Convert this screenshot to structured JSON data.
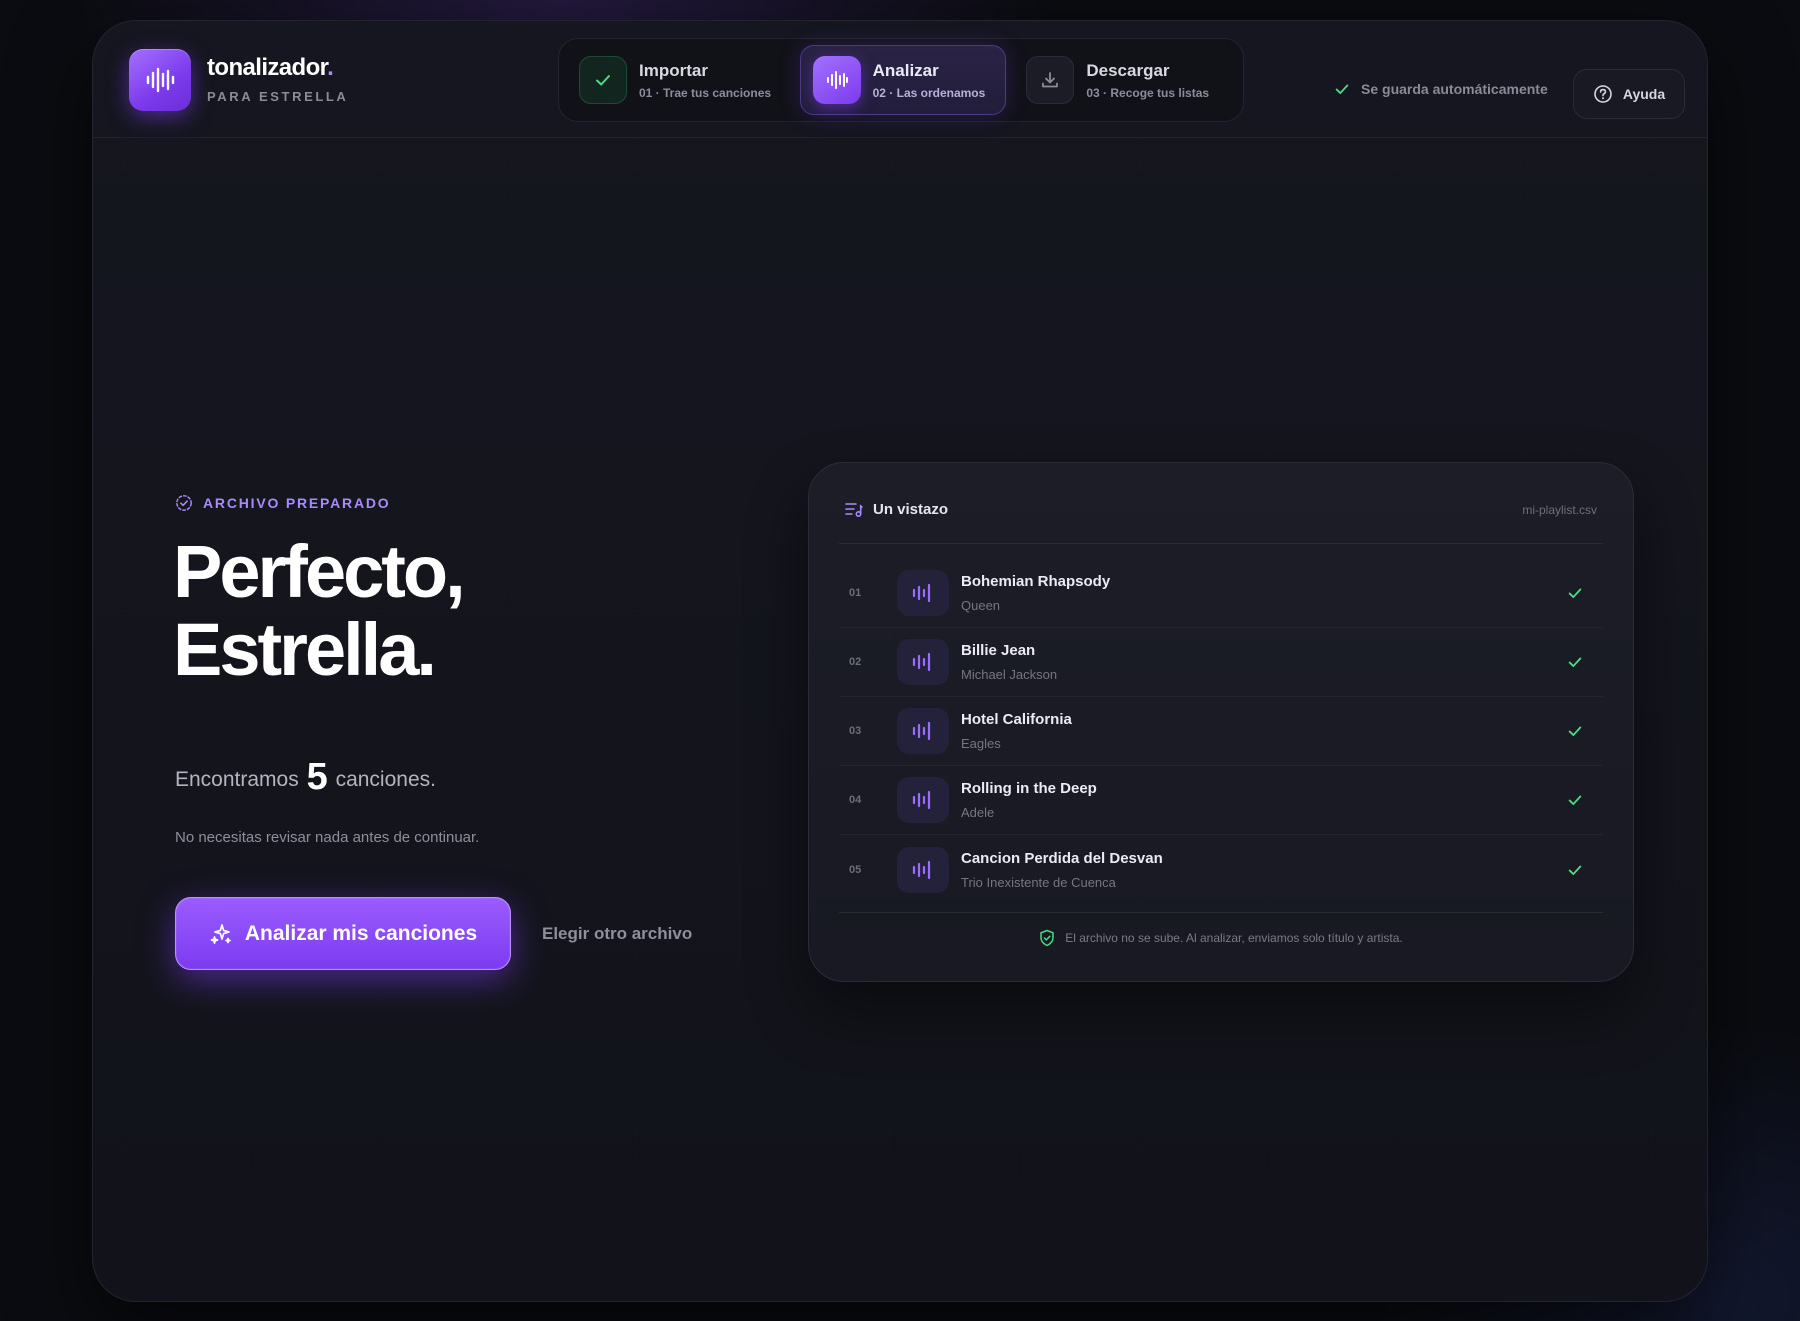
{
  "brand": {
    "name": "tonalizador",
    "dot": ".",
    "subtitle": "PARA ESTRELLA",
    "logo_icon": "waveform-icon"
  },
  "stepper": {
    "steps": [
      {
        "title": "Importar",
        "subtitle": "01 · Trae tus canciones",
        "state": "done",
        "icon": "check-icon"
      },
      {
        "title": "Analizar",
        "subtitle": "02 · Las ordenamos",
        "state": "active",
        "icon": "waveform-icon"
      },
      {
        "title": "Descargar",
        "subtitle": "03 · Recoge tus listas",
        "state": "pending",
        "icon": "download-icon"
      }
    ]
  },
  "header": {
    "autosave": "Se guarda automáticamente",
    "help_label": "Ayuda"
  },
  "main": {
    "eyebrow": "ARCHIVO PREPARADO",
    "headline_line1": "Perfecto,",
    "headline_line2": "Estrella.",
    "found_prefix": "Encontramos",
    "found_count": "5",
    "found_suffix": "canciones.",
    "note": "No necesitas revisar nada antes de continuar.",
    "cta_label": "Analizar mis canciones",
    "alt_link": "Elegir otro archivo"
  },
  "preview": {
    "title": "Un vistazo",
    "filename": "mi-playlist.csv",
    "songs": [
      {
        "num": "01",
        "title": "Bohemian Rhapsody",
        "artist": "Queen"
      },
      {
        "num": "02",
        "title": "Billie Jean",
        "artist": "Michael Jackson"
      },
      {
        "num": "03",
        "title": "Hotel California",
        "artist": "Eagles"
      },
      {
        "num": "04",
        "title": "Rolling in the Deep",
        "artist": "Adele"
      },
      {
        "num": "05",
        "title": "Cancion Perdida del Desvan",
        "artist": "Trio Inexistente de Cuenca"
      }
    ],
    "footer": "El archivo no se sube. Al analizar, enviamos solo título y artista."
  },
  "colors": {
    "accent": "#7c3aed",
    "accent_light": "#a78bfa",
    "success": "#4ade80",
    "background": "#12131a"
  }
}
